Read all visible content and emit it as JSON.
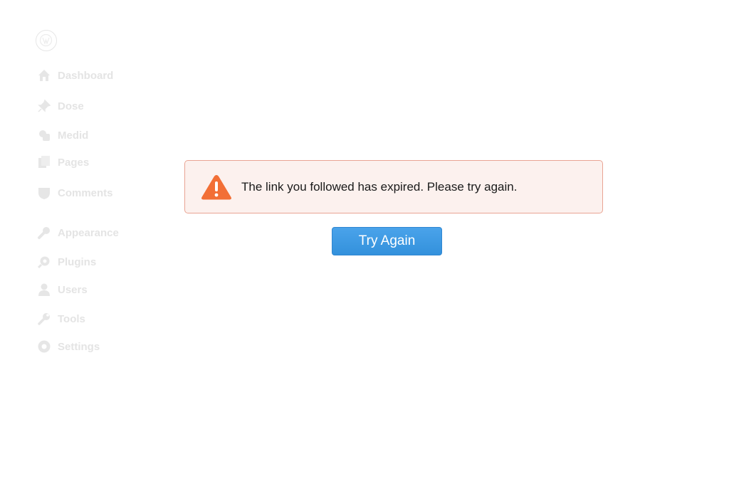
{
  "sidebar": {
    "items": [
      {
        "label": "Dashboard",
        "icon": "home-icon"
      },
      {
        "label": "Dose",
        "icon": "pin-icon"
      },
      {
        "label": "Medid",
        "icon": "media-icon"
      },
      {
        "label": "Pages",
        "icon": "pages-icon"
      },
      {
        "label": "Comments",
        "icon": "comments-icon"
      },
      {
        "label": "Appearance",
        "icon": "brush-icon"
      },
      {
        "label": "Plugins",
        "icon": "plugin-icon"
      },
      {
        "label": "Users",
        "icon": "user-icon"
      },
      {
        "label": "Tools",
        "icon": "wrench-icon"
      },
      {
        "label": "Settings",
        "icon": "gear-icon"
      }
    ]
  },
  "notice": {
    "message": "The link you followed has expired. Please try again.",
    "icon": "warning-icon",
    "border_color": "#e9a493",
    "background_color": "#fcf1ee",
    "icon_color": "#f26f36"
  },
  "action": {
    "label": "Try Again",
    "color": "#3a97e2"
  }
}
